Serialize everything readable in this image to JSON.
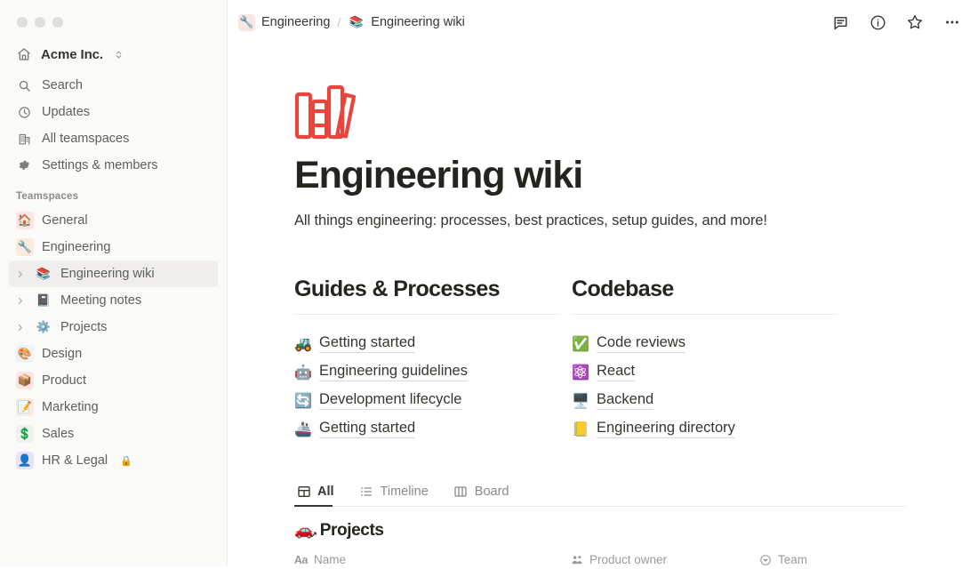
{
  "window": {
    "controls": [
      "close",
      "minimize",
      "maximize"
    ]
  },
  "sidebar": {
    "workspace": {
      "name": "Acme Inc.",
      "icon": "home-icon"
    },
    "nav": [
      {
        "label": "Search",
        "icon": "search-icon"
      },
      {
        "label": "Updates",
        "icon": "clock-icon"
      },
      {
        "label": "All teamspaces",
        "icon": "building-icon"
      },
      {
        "label": "Settings & members",
        "icon": "gear-icon"
      }
    ],
    "teamspaces_label": "Teamspaces",
    "teamspaces": [
      {
        "label": "General",
        "emoji": "🏠",
        "bg": "#FBE4E4",
        "expandable": false,
        "selected": false,
        "locked": false
      },
      {
        "label": "Engineering",
        "emoji": "🔧",
        "bg": "#FAEBDD",
        "expandable": false,
        "selected": false,
        "locked": false
      },
      {
        "label": "Engineering wiki",
        "emoji": "📚",
        "bg": "transparent",
        "expandable": true,
        "selected": true,
        "locked": false
      },
      {
        "label": "Meeting notes",
        "emoji": "📓",
        "bg": "transparent",
        "expandable": true,
        "selected": false,
        "locked": false
      },
      {
        "label": "Projects",
        "emoji": "⚙️",
        "bg": "transparent",
        "expandable": true,
        "selected": false,
        "locked": false
      },
      {
        "label": "Design",
        "emoji": "🎨",
        "bg": "#EDF3FA",
        "expandable": false,
        "selected": false,
        "locked": false
      },
      {
        "label": "Product",
        "emoji": "📦",
        "bg": "#FBE4E4",
        "expandable": false,
        "selected": false,
        "locked": false
      },
      {
        "label": "Marketing",
        "emoji": "📝",
        "bg": "#FAEBDD",
        "expandable": false,
        "selected": false,
        "locked": false
      },
      {
        "label": "Sales",
        "emoji": "💲",
        "bg": "#F1F1EF",
        "expandable": false,
        "selected": false,
        "locked": false
      },
      {
        "label": "HR & Legal",
        "emoji": "👤",
        "bg": "#EAE4F2",
        "expandable": false,
        "selected": false,
        "locked": true
      }
    ]
  },
  "topbar": {
    "breadcrumb": [
      {
        "label": "Engineering",
        "emoji": "🔧",
        "bg": "#FBE4E4"
      },
      {
        "label": "Engineering wiki",
        "emoji": "📚",
        "bg": "transparent"
      }
    ],
    "separator": "/",
    "actions": [
      {
        "name": "comment-icon",
        "label": "Comments"
      },
      {
        "name": "info-icon",
        "label": "Page info"
      },
      {
        "name": "star-icon",
        "label": "Favorite"
      },
      {
        "name": "more-icon",
        "label": "More"
      }
    ]
  },
  "page": {
    "icon": "books-icon",
    "icon_color": "#E8453C",
    "title": "Engineering wiki",
    "subtitle": "All things engineering: processes, best practices, setup guides, and more!"
  },
  "columns": [
    {
      "heading": "Guides & Processes",
      "links": [
        {
          "label": "Getting started",
          "emoji": "🚜"
        },
        {
          "label": "Engineering guidelines",
          "emoji": "🤖"
        },
        {
          "label": "Development lifecycle",
          "emoji": "🔄"
        },
        {
          "label": "Getting started",
          "emoji": "🚢"
        }
      ]
    },
    {
      "heading": "Codebase",
      "links": [
        {
          "label": "Code reviews",
          "emoji": "✅"
        },
        {
          "label": "React",
          "emoji": "⚛️"
        },
        {
          "label": "Backend",
          "emoji": "🖥️"
        },
        {
          "label": "Engineering directory",
          "emoji": "📒"
        }
      ]
    }
  ],
  "database": {
    "tabs": [
      {
        "label": "All",
        "icon": "table-icon",
        "active": true
      },
      {
        "label": "Timeline",
        "icon": "list-icon",
        "active": false
      },
      {
        "label": "Board",
        "icon": "board-icon",
        "active": false
      }
    ],
    "title": "Projects",
    "title_emoji": "🚗",
    "columns": [
      {
        "label": "Name",
        "icon": "text-icon",
        "prefix": "Aa"
      },
      {
        "label": "Product owner",
        "icon": "person-icon",
        "prefix": ""
      },
      {
        "label": "Team",
        "icon": "select-icon",
        "prefix": ""
      }
    ]
  }
}
